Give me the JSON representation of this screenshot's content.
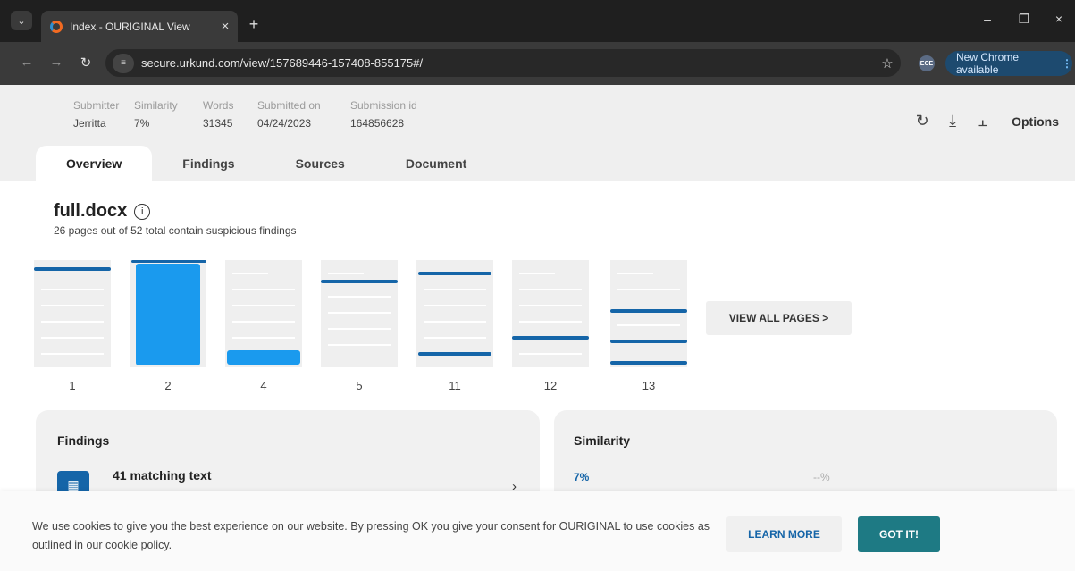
{
  "browser": {
    "tab_title": "Index - OURIGINAL View",
    "url": "secure.urkund.com/view/157689446-157408-855175#/",
    "extension_label": "ECE",
    "update_label": "New Chrome available"
  },
  "header": {
    "meta": [
      {
        "label": "Submitter",
        "value": "Jerritta"
      },
      {
        "label": "Similarity",
        "value": "7%"
      },
      {
        "label": "Words",
        "value": "31345"
      },
      {
        "label": "Submitted on",
        "value": "04/24/2023"
      },
      {
        "label": "Submission id",
        "value": "164856628"
      }
    ],
    "options_label": "Options",
    "tabs": [
      "Overview",
      "Findings",
      "Sources",
      "Document"
    ],
    "active_tab": "Overview"
  },
  "overview": {
    "file_name": "full.docx",
    "summary": "26 pages out of 52 total contain suspicious findings",
    "pages": [
      "1",
      "2",
      "4",
      "5",
      "11",
      "12",
      "13"
    ],
    "view_all_label": "VIEW ALL PAGES >"
  },
  "findings_card": {
    "title": "Findings",
    "match_label": "41 matching text"
  },
  "similarity_card": {
    "title": "Similarity",
    "value": "7%",
    "value2": "--%"
  },
  "cookie": {
    "text": "We use cookies to give you the best experience on our website. By pressing OK you give your consent for OURIGINAL to use cookies as outlined in our cookie policy.",
    "learn_more": "LEARN MORE",
    "got_it": "GOT IT!"
  },
  "colors": {
    "accent": "#1565a8",
    "highlight": "#1a9aee",
    "primary_button": "#1e7a84"
  }
}
